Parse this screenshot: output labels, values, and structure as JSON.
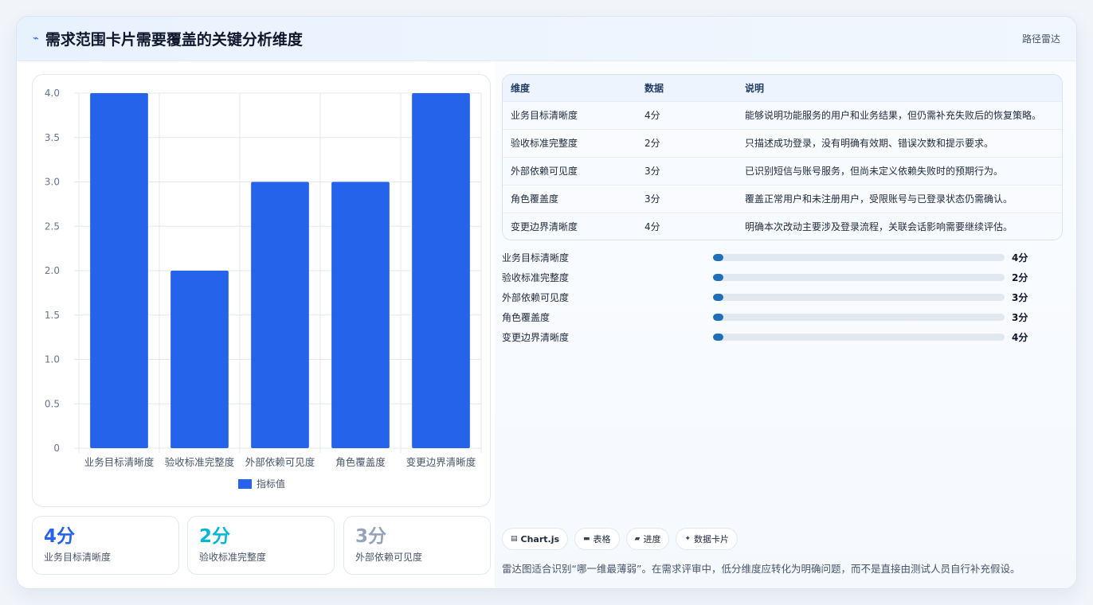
{
  "header": {
    "icon": "bolt-icon",
    "title": "需求范围卡片需要覆盖的关键分析维度",
    "route": "路径雷达"
  },
  "chart_data": {
    "type": "bar",
    "categories": [
      "业务目标清晰度",
      "验收标准完整度",
      "外部依赖可见度",
      "角色覆盖度",
      "变更边界清晰度"
    ],
    "series": [
      {
        "name": "指标值",
        "values": [
          4,
          2,
          3,
          3,
          4
        ],
        "color": "#2563eb"
      }
    ],
    "ylim": [
      0,
      4
    ],
    "yticks": [
      "0",
      "0.5",
      "1.0",
      "1.5",
      "2.0",
      "2.5",
      "3.0",
      "3.5",
      "4.0"
    ],
    "grid": true,
    "legend": "bottom"
  },
  "kpis": [
    {
      "value": "4分",
      "label": "业务目标清晰度",
      "color": "#2563eb"
    },
    {
      "value": "2分",
      "label": "验收标准完整度",
      "color": "#06b6d4"
    },
    {
      "value": "3分",
      "label": "外部依赖可见度",
      "color": "#94a3b8"
    }
  ],
  "table": {
    "headers": [
      "维度",
      "数据",
      "说明"
    ],
    "rows": [
      [
        "业务目标清晰度",
        "4分",
        "能够说明功能服务的用户和业务结果，但仍需补充失败后的恢复策略。"
      ],
      [
        "验收标准完整度",
        "2分",
        "只描述成功登录，没有明确有效期、错误次数和提示要求。"
      ],
      [
        "外部依赖可见度",
        "3分",
        "已识别短信与账号服务，但尚未定义依赖失败时的预期行为。"
      ],
      [
        "角色覆盖度",
        "3分",
        "覆盖正常用户和未注册用户，受限账号与已登录状态仍需确认。"
      ],
      [
        "变更边界清晰度",
        "4分",
        "明确本次改动主要涉及登录流程，关联会话影响需要继续评估。"
      ]
    ]
  },
  "progress": [
    {
      "label": "业务目标清晰度",
      "value": "4分"
    },
    {
      "label": "验收标准完整度",
      "value": "2分"
    },
    {
      "label": "外部依赖可见度",
      "value": "3分"
    },
    {
      "label": "角色覆盖度",
      "value": "3分"
    },
    {
      "label": "变更边界清晰度",
      "value": "4分"
    }
  ],
  "tags": [
    {
      "icon": "chart-icon",
      "label": "Chart.js"
    },
    {
      "icon": "table-icon",
      "label": "表格"
    },
    {
      "icon": "progress-icon",
      "label": "进度"
    },
    {
      "icon": "sparkle-icon",
      "label": "数据卡片"
    }
  ],
  "footnote": "雷达图适合识别“哪一维最薄弱”。在需求评审中，低分维度应转化为明确问题，而不是直接由测试人员自行补充假设。"
}
